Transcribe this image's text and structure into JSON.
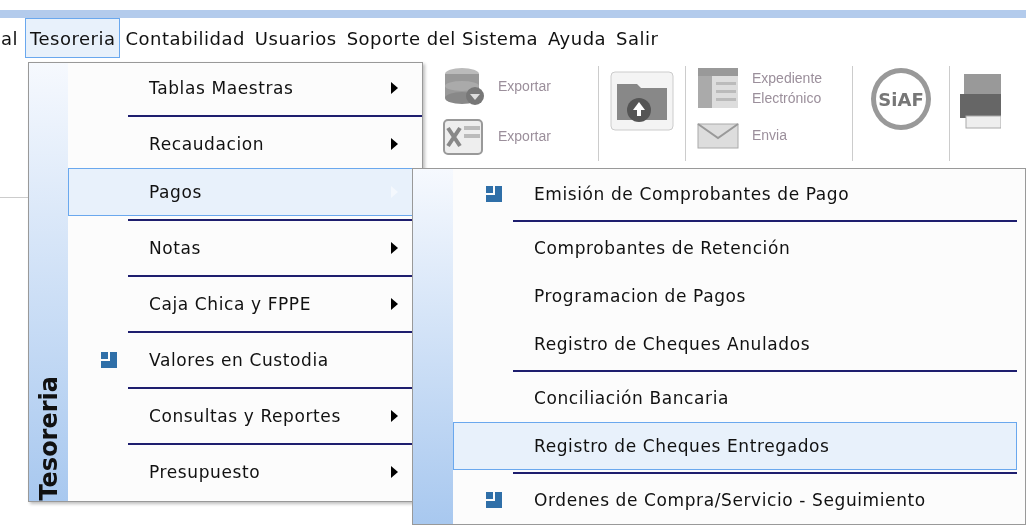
{
  "menu_bar": [
    {
      "label": "al",
      "selected": false
    },
    {
      "label": "Tesoreria",
      "selected": true
    },
    {
      "label": "Contabilidad",
      "selected": false
    },
    {
      "label": "Usuarios",
      "selected": false
    },
    {
      "label": "Soporte del Sistema",
      "selected": false
    },
    {
      "label": "Ayuda",
      "selected": false
    },
    {
      "label": "Salir",
      "selected": false
    }
  ],
  "toolbar": [
    {
      "kind": "stack",
      "items": [
        {
          "kind": "database",
          "label": "Exportar"
        },
        {
          "kind": "spreadsheet",
          "label": "Exportar"
        }
      ]
    },
    {
      "kind": "folder"
    },
    {
      "kind": "stack",
      "items": [
        {
          "kind": "file",
          "label": "Expediente Electrónico"
        },
        {
          "kind": "envelope",
          "label": "Envia"
        }
      ]
    },
    {
      "kind": "logo",
      "label": "SiAF"
    },
    {
      "kind": "printer"
    }
  ],
  "menu": {
    "title": "Tesoreria",
    "items": [
      {
        "label": "Tablas Maestras",
        "submenu": true,
        "has_icon": false,
        "selected": false,
        "separator_after": true
      },
      {
        "label": "Recaudacion",
        "submenu": true,
        "has_icon": false,
        "selected": false,
        "separator_after": false
      },
      {
        "label": "Pagos",
        "submenu": true,
        "has_icon": false,
        "selected": true,
        "separator_after": true
      },
      {
        "label": "Notas",
        "submenu": true,
        "has_icon": false,
        "selected": false,
        "separator_after": true
      },
      {
        "label": "Caja Chica y FPPE",
        "submenu": true,
        "has_icon": false,
        "selected": false,
        "separator_after": true
      },
      {
        "label": "Valores en Custodia",
        "submenu": false,
        "has_icon": true,
        "selected": false,
        "separator_after": true
      },
      {
        "label": "Consultas y Reportes",
        "submenu": true,
        "has_icon": false,
        "selected": false,
        "separator_after": true
      },
      {
        "label": "Presupuesto",
        "submenu": true,
        "has_icon": false,
        "selected": false,
        "separator_after": false
      }
    ]
  },
  "submenu": {
    "items": [
      {
        "label": "Emisión de Comprobantes de Pago",
        "has_icon": true,
        "selected": false,
        "separator_after": true
      },
      {
        "label": "Comprobantes de Retención",
        "has_icon": false,
        "selected": false,
        "separator_after": false
      },
      {
        "label": "Programacion de Pagos",
        "has_icon": false,
        "selected": false,
        "separator_after": false
      },
      {
        "label": "Registro de Cheques Anulados",
        "has_icon": false,
        "selected": false,
        "separator_after": true
      },
      {
        "label": "Conciliación Bancaria",
        "has_icon": false,
        "selected": false,
        "separator_after": false
      },
      {
        "label": "Registro de Cheques Entregados",
        "has_icon": false,
        "selected": true,
        "separator_after": true
      },
      {
        "label": "Ordenes de Compra/Servicio - Seguimiento",
        "has_icon": true,
        "selected": false,
        "separator_after": false
      }
    ]
  }
}
